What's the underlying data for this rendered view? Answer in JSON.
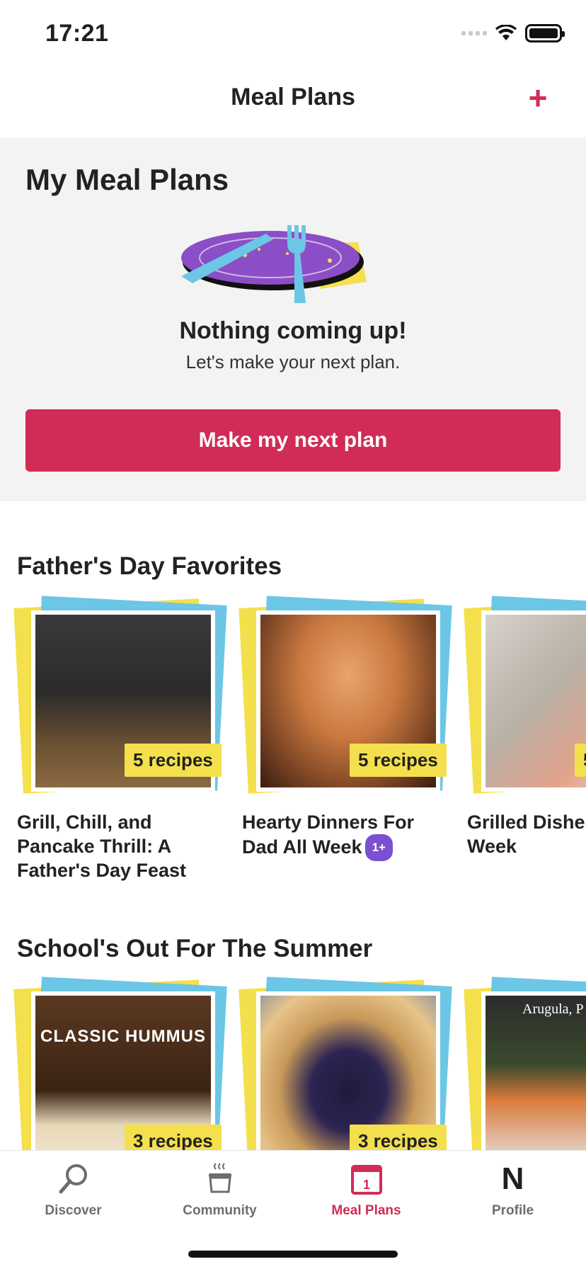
{
  "status_bar": {
    "time": "17:21"
  },
  "header": {
    "title": "Meal Plans",
    "add_icon": "+"
  },
  "my_meal_plans": {
    "title": "My Meal Plans",
    "empty_title": "Nothing coming up!",
    "empty_subtitle": "Let's make your next plan.",
    "button_label": "Make my next plan"
  },
  "sections": [
    {
      "title": "Father's Day Favorites",
      "cards": [
        {
          "title": "Grill, Chill, and Pancake Thrill: A Father's Day Feast",
          "badge": "5 recipes"
        },
        {
          "title": "Hearty Dinners For Dad All Week",
          "badge": "5 recipes",
          "plus_badge": "1+"
        },
        {
          "title": "Grilled Dishes All Week",
          "badge": "5"
        }
      ]
    },
    {
      "title": "School's Out For The Summer",
      "cards": [
        {
          "photo_text": "CLASSIC HUMMUS",
          "badge": "3 recipes"
        },
        {
          "badge": "3 recipes"
        },
        {
          "photo_text": "Arugula, P & Goat Ch"
        }
      ]
    }
  ],
  "tabs": [
    {
      "label": "Discover",
      "icon": "search-icon"
    },
    {
      "label": "Community",
      "icon": "pot-icon"
    },
    {
      "label": "Meal Plans",
      "icon": "calendar-icon",
      "calendar_day": "1",
      "active": true
    },
    {
      "label": "Profile",
      "icon": "profile-n-icon",
      "glyph": "N"
    }
  ],
  "colors": {
    "accent": "#d12c55",
    "badge_yellow": "#f4e04d",
    "stack_blue": "#6cc6e5",
    "plus_purple": "#7b4fd0"
  }
}
